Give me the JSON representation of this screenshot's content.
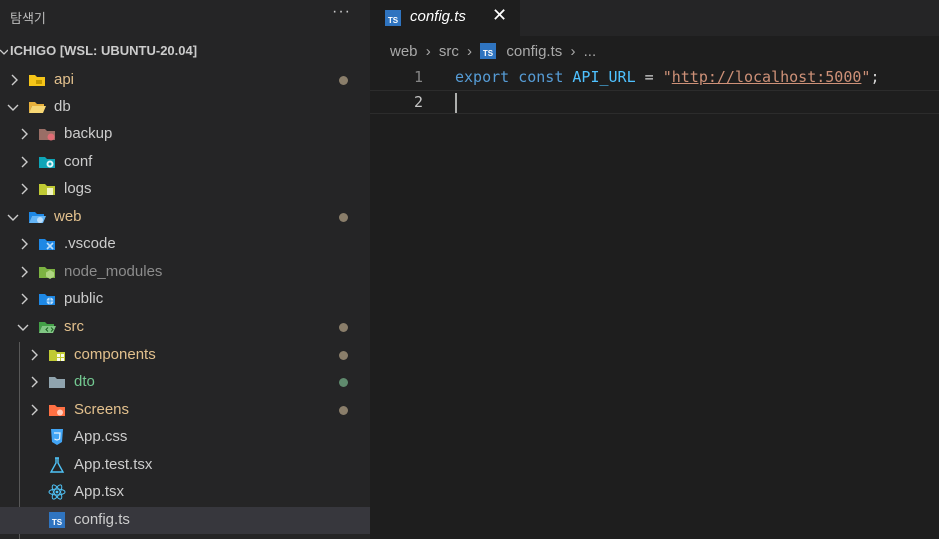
{
  "sidebar": {
    "title": "탐색기",
    "more_label": "···",
    "workspace": "ICHIGO [WSL: UBUNTU-20.04]",
    "items": [
      {
        "label": "api",
        "color": "#e2c08d",
        "expanded": false
      },
      {
        "label": "db",
        "color": "#cccccc",
        "expanded": true
      },
      {
        "label": "backup",
        "color": "#cccccc",
        "expanded": false
      },
      {
        "label": "conf",
        "color": "#cccccc",
        "expanded": false
      },
      {
        "label": "logs",
        "color": "#cccccc",
        "expanded": false
      },
      {
        "label": "web",
        "color": "#e2c08d",
        "expanded": true
      },
      {
        "label": ".vscode",
        "color": "#cccccc",
        "expanded": false
      },
      {
        "label": "node_modules",
        "color": "#8c8c8c",
        "expanded": false
      },
      {
        "label": "public",
        "color": "#cccccc",
        "expanded": false
      },
      {
        "label": "src",
        "color": "#e2c08d",
        "expanded": true
      },
      {
        "label": "components",
        "color": "#e2c08d",
        "expanded": false
      },
      {
        "label": "dto",
        "color": "#73c991",
        "expanded": false
      },
      {
        "label": "Screens",
        "color": "#e2c08d",
        "expanded": false
      },
      {
        "label": "App.css",
        "color": "#cccccc"
      },
      {
        "label": "App.test.tsx",
        "color": "#cccccc"
      },
      {
        "label": "App.tsx",
        "color": "#cccccc"
      },
      {
        "label": "config.ts",
        "color": "#cccccc",
        "selected": true
      }
    ]
  },
  "editor": {
    "tab_label": "config.ts",
    "tab_close": "✕",
    "breadcrumb": [
      "web",
      "src",
      "config.ts",
      "..."
    ],
    "ts_badge": "TS",
    "lines": [
      {
        "number": "1",
        "tokens": {
          "kw1": "export",
          "kw2": "const",
          "name": "API_URL",
          "eq": "=",
          "q1": "\"",
          "url": "http://localhost:5000",
          "q2": "\"",
          "semi": ";"
        }
      },
      {
        "number": "2"
      }
    ]
  },
  "colors": {
    "modified_dot": "#8a7e6a",
    "added_dot": "#5f8a6d",
    "ts_blue": "#2f74c0"
  }
}
